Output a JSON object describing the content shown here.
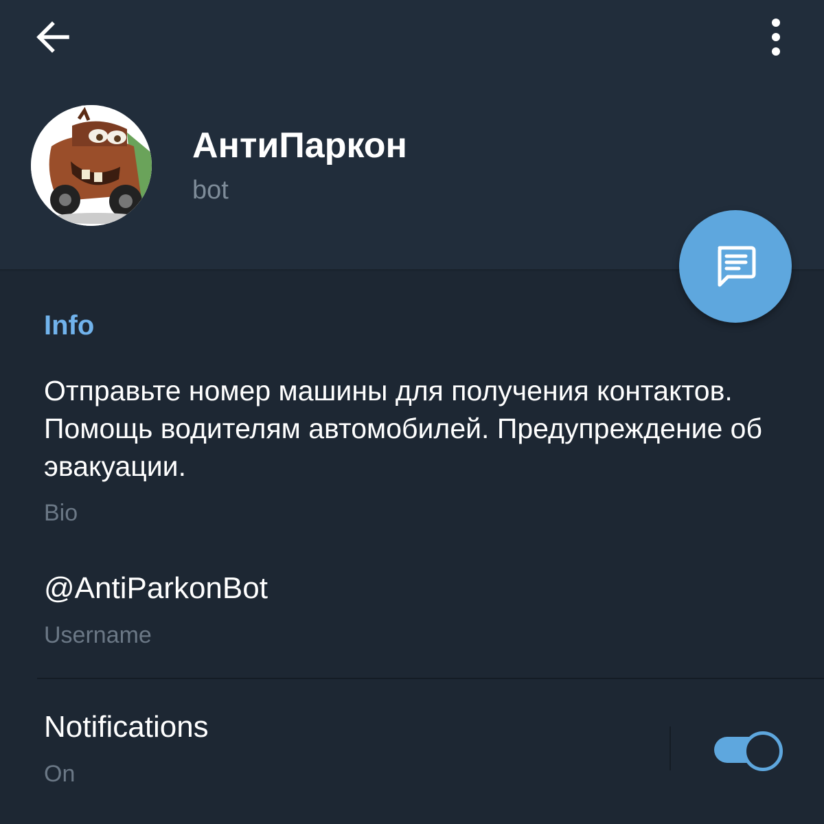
{
  "toolbar": {
    "back_icon": "arrow-left-icon",
    "menu_icon": "more-vertical-icon"
  },
  "profile": {
    "name": "АнтиПаркон",
    "status": "bot",
    "avatar_icon": "avatar-image"
  },
  "fab": {
    "icon": "message-icon"
  },
  "info": {
    "section_title": "Info",
    "bio": {
      "value": "Отправьте номер машины для получения контактов. Помощь водителям автомобилей. Предупреждение об эвакуации.",
      "label": "Bio"
    },
    "username": {
      "value": "@AntiParkonBot",
      "label": "Username"
    }
  },
  "notifications": {
    "title": "Notifications",
    "status": "On",
    "enabled": true
  },
  "colors": {
    "background": "#1d2733",
    "header": "#212d3b",
    "accent": "#5ea7de",
    "section_title": "#71b3ec",
    "secondary_text": "#6b7886"
  }
}
